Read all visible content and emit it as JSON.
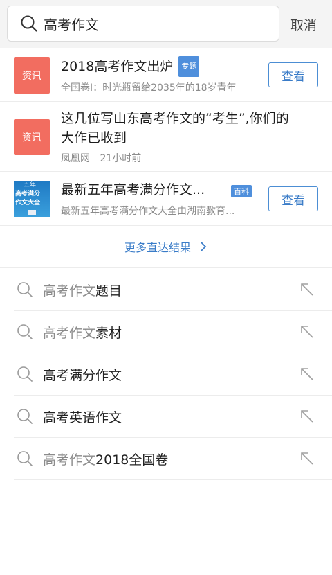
{
  "search": {
    "query": "高考作文",
    "cancel_label": "取消"
  },
  "results": [
    {
      "tag": "资讯",
      "title": "2018高考作文出炉",
      "badge": "专题",
      "subtitle": "全国卷I：时光瓶留给2035年的18岁青年",
      "button_label": "查看"
    },
    {
      "tag": "资讯",
      "title_line1": "这几位写山东高考作文的“考生”,你们的",
      "title_line2": "大作已收到",
      "source": "凤凰网",
      "time": "21小时前"
    },
    {
      "thumb_lines": [
        "五年",
        "高考满分",
        "作文大全"
      ],
      "title": "最新五年高考满分作文...",
      "badge": "百科",
      "subtitle": "最新五年高考满分作文大全由湖南教育...",
      "button_label": "查看"
    }
  ],
  "more_label": "更多直达结果",
  "suggestions": [
    {
      "prefix": "高考作文",
      "suffix": "题目"
    },
    {
      "prefix": "高考作文",
      "suffix": "素材"
    },
    {
      "prefix": "",
      "suffix": "高考满分作文"
    },
    {
      "prefix": "",
      "suffix": "高考英语作文"
    },
    {
      "prefix": "高考作文",
      "suffix": "2018全国卷"
    }
  ],
  "colors": {
    "accent": "#3a7cc8",
    "tag_red": "#f26d60",
    "badge_blue": "#4f8fdc"
  }
}
